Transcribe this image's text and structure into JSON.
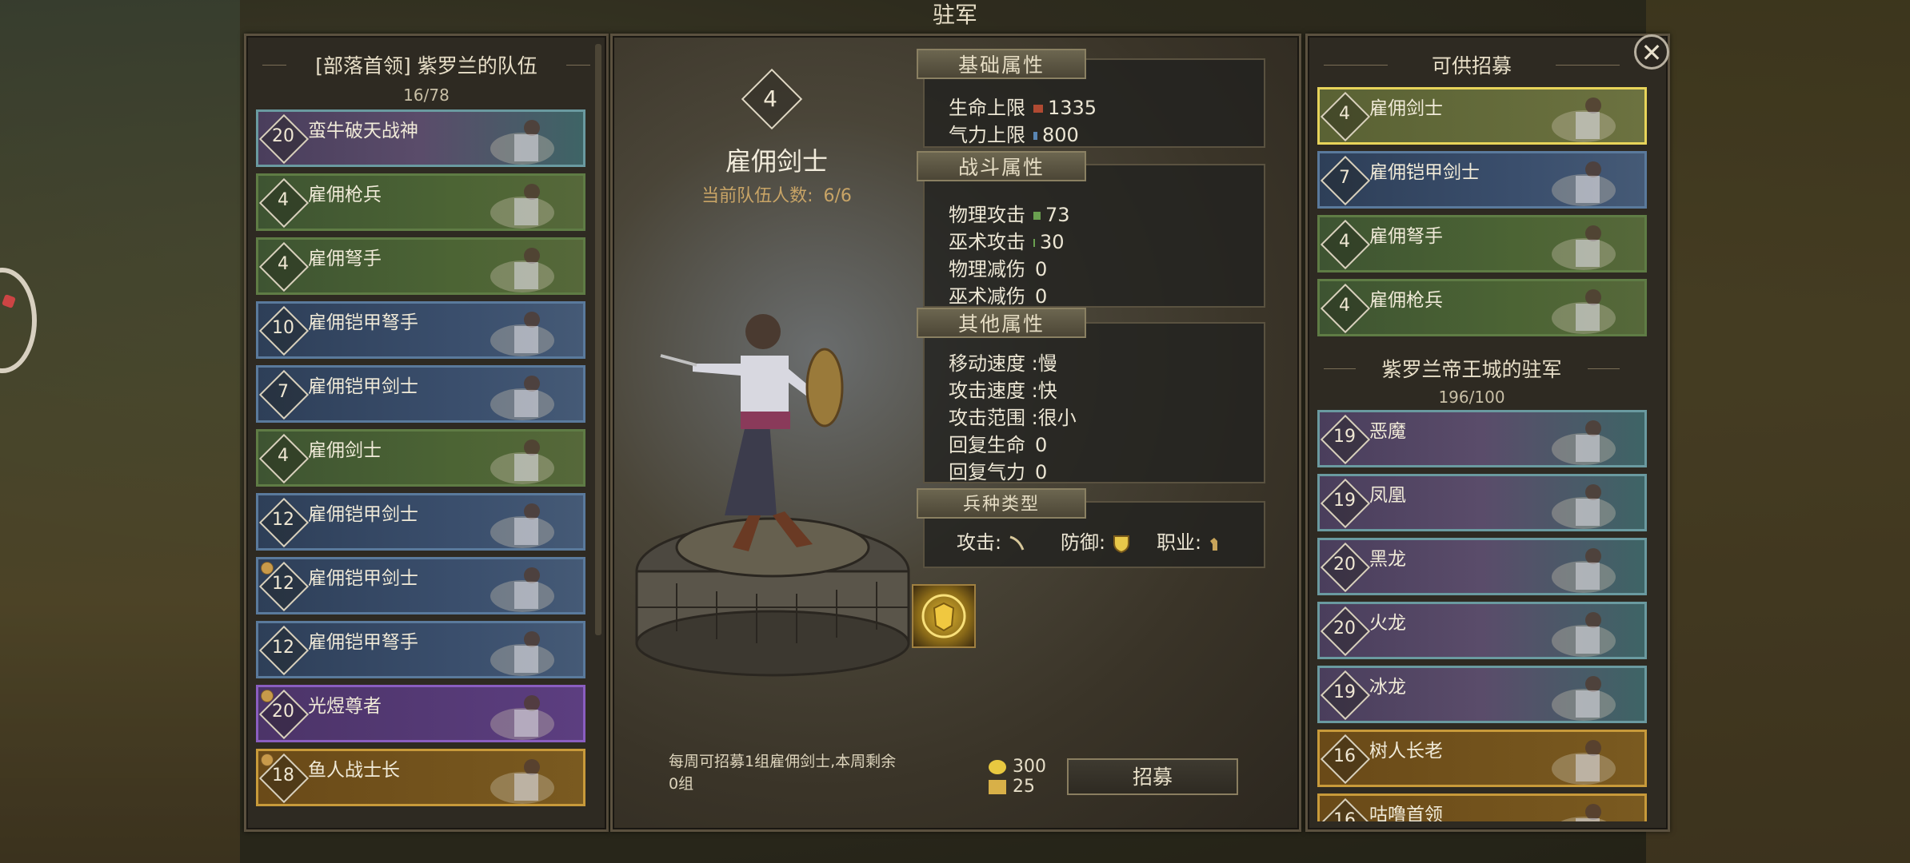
{
  "window_title": "驻军",
  "left_panel": {
    "title": "[部落首领] 紫罗兰的队伍",
    "count": "16/78",
    "units": [
      {
        "level": "20",
        "name": "蛮牛破天战神",
        "style": "iri",
        "medal": false
      },
      {
        "level": "4",
        "name": "雇佣枪兵",
        "style": "green",
        "medal": false
      },
      {
        "level": "4",
        "name": "雇佣弩手",
        "style": "green",
        "medal": false
      },
      {
        "level": "10",
        "name": "雇佣铠甲弩手",
        "style": "blue",
        "medal": false
      },
      {
        "level": "7",
        "name": "雇佣铠甲剑士",
        "style": "blue",
        "medal": false
      },
      {
        "level": "4",
        "name": "雇佣剑士",
        "style": "green",
        "medal": false
      },
      {
        "level": "12",
        "name": "雇佣铠甲剑士",
        "style": "blue",
        "medal": false
      },
      {
        "level": "12",
        "name": "雇佣铠甲剑士",
        "style": "blue",
        "medal": true
      },
      {
        "level": "12",
        "name": "雇佣铠甲弩手",
        "style": "blue",
        "medal": false
      },
      {
        "level": "20",
        "name": "光煜尊者",
        "style": "purple",
        "medal": true
      },
      {
        "level": "18",
        "name": "鱼人战士长",
        "style": "gold",
        "medal": true
      }
    ]
  },
  "center_panel": {
    "level": "4",
    "unit_name": "雇佣剑士",
    "party_label": "当前队伍人数:",
    "party_count": "6/6",
    "basic": {
      "title": "基础属性",
      "hp_label": "生命上限",
      "hp_value": "1335",
      "stamina_label": "气力上限",
      "stamina_value": "800"
    },
    "combat": {
      "title": "战斗属性",
      "phys_atk_label": "物理攻击",
      "phys_atk_value": "73",
      "magic_atk_label": "巫术攻击",
      "magic_atk_value": "30",
      "phys_def_label": "物理减伤",
      "phys_def_value": "0",
      "magic_def_label": "巫术减伤",
      "magic_def_value": "0"
    },
    "other": {
      "title": "其他属性",
      "move_speed": "移动速度 :慢",
      "atk_speed": "攻击速度 :快",
      "atk_range": "攻击范围 :很小",
      "regen_hp_label": "回复生命",
      "regen_hp_value": "0",
      "regen_stamina_label": "回复气力",
      "regen_stamina_value": "0"
    },
    "type": {
      "title": "兵种类型",
      "attack_label": "攻击:",
      "defense_label": "防御:",
      "class_label": "职业:",
      "attack_icon": "sword-icon",
      "defense_icon": "shield-icon",
      "class_icon": "foot-soldier-icon"
    },
    "skill_icon": "golden-armor-skill-icon",
    "recruit_note_line1": "每周可招募1组雇佣剑士,本周剩余",
    "recruit_note_line2": "0组",
    "cost_gold": "300",
    "cost_food": "25",
    "recruit_button": "招募"
  },
  "right_panel": {
    "title": "可供招募",
    "available": [
      {
        "level": "4",
        "name": "雇佣剑士",
        "style": "selected"
      },
      {
        "level": "7",
        "name": "雇佣铠甲剑士",
        "style": "blue"
      },
      {
        "level": "4",
        "name": "雇佣弩手",
        "style": "green"
      },
      {
        "level": "4",
        "name": "雇佣枪兵",
        "style": "green"
      }
    ],
    "garrison_title": "紫罗兰帝王城的驻军",
    "garrison_count": "196/100",
    "garrison": [
      {
        "level": "19",
        "name": "恶魔",
        "style": "iri"
      },
      {
        "level": "19",
        "name": "凤凰",
        "style": "iri"
      },
      {
        "level": "20",
        "name": "黑龙",
        "style": "iri"
      },
      {
        "level": "20",
        "name": "火龙",
        "style": "iri"
      },
      {
        "level": "19",
        "name": "冰龙",
        "style": "iri"
      },
      {
        "level": "16",
        "name": "树人长老",
        "style": "gold"
      },
      {
        "level": "16",
        "name": "咕噜首领",
        "style": "gold"
      }
    ]
  },
  "colors": {
    "panel_bg": "#2e2a22",
    "panel_border": "#5b513f",
    "hp_bar": "#b04a32",
    "stamina_bar": "#5a86b4",
    "atk_bar": "#6aa050",
    "selected_border": "#e8d45a"
  }
}
